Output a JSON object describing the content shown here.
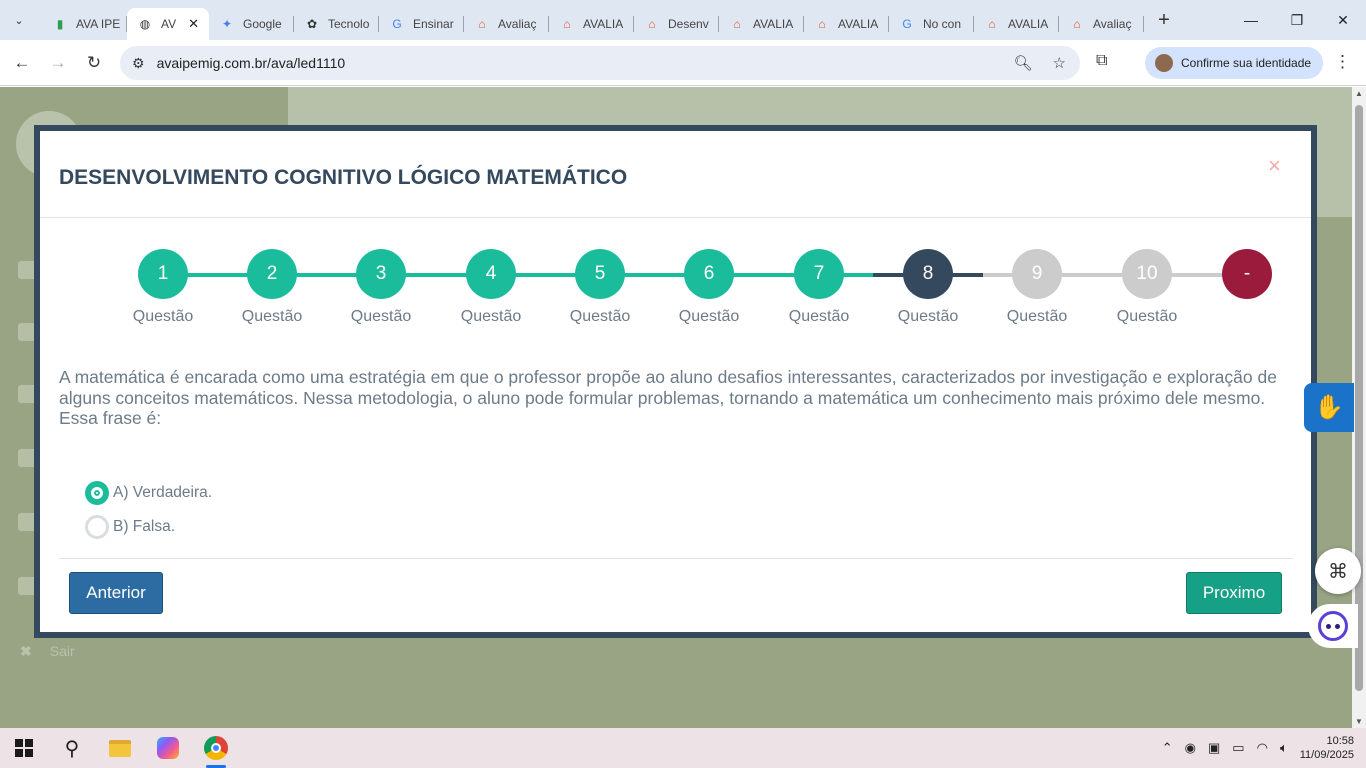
{
  "browser": {
    "tabs": [
      {
        "label": "AVA IPE",
        "icon": "ava-favicon",
        "active": false
      },
      {
        "label": "AV",
        "icon": "globe-icon",
        "active": true
      },
      {
        "label": "Google",
        "icon": "gemini-icon",
        "active": false
      },
      {
        "label": "Tecnolo",
        "icon": "openai-icon",
        "active": false
      },
      {
        "label": "Ensinar",
        "icon": "google-icon",
        "active": false
      },
      {
        "label": "Avaliaç",
        "icon": "ava-house-icon",
        "active": false
      },
      {
        "label": "AVALIA",
        "icon": "ava-house-icon",
        "active": false
      },
      {
        "label": "Desenv",
        "icon": "ava-house-icon",
        "active": false
      },
      {
        "label": "AVALIA",
        "icon": "ava-house-icon",
        "active": false
      },
      {
        "label": "AVALIA",
        "icon": "ava-house-icon",
        "active": false
      },
      {
        "label": "No con",
        "icon": "google-icon",
        "active": false
      },
      {
        "label": "AVALIA",
        "icon": "ava-house-icon",
        "active": false
      },
      {
        "label": "Avaliaç",
        "icon": "ava-house-icon",
        "active": false
      }
    ],
    "url": "avaipemig.com.br/ava/led1110",
    "profile_label": "Confirme sua identidade"
  },
  "page_bg": {
    "sidebar_exit": "Sair"
  },
  "modal": {
    "title": "DESENVOLVIMENTO COGNITIVO LÓGICO MATEMÁTICO",
    "close": "×",
    "steps": [
      {
        "num": "1",
        "label": "Questão",
        "state": "done"
      },
      {
        "num": "2",
        "label": "Questão",
        "state": "done"
      },
      {
        "num": "3",
        "label": "Questão",
        "state": "done"
      },
      {
        "num": "4",
        "label": "Questão",
        "state": "done"
      },
      {
        "num": "5",
        "label": "Questão",
        "state": "done"
      },
      {
        "num": "6",
        "label": "Questão",
        "state": "done"
      },
      {
        "num": "7",
        "label": "Questão",
        "state": "done"
      },
      {
        "num": "8",
        "label": "Questão",
        "state": "current"
      },
      {
        "num": "9",
        "label": "Questão",
        "state": "todo"
      },
      {
        "num": "10",
        "label": "Questão",
        "state": "todo"
      },
      {
        "num": "-",
        "label": "",
        "state": "end"
      }
    ],
    "question": "A matemática é encarada como uma estratégia em que o professor propõe ao aluno desafios interessantes, caracterizados por investigação e exploração de alguns conceitos matemáticos. Nessa metodologia, o aluno pode formular problemas, tornando a matemática um conhecimento mais próximo dele mesmo. Essa frase é:",
    "options": [
      {
        "label": "A) Verdadeira.",
        "selected": true
      },
      {
        "label": "B) Falsa.",
        "selected": false
      }
    ],
    "prev_label": "Anterior",
    "next_label": "Proximo"
  },
  "colors": {
    "done": "#1abc9c",
    "current": "#34495e",
    "todo": "#cccccc",
    "end": "#9b1b3d",
    "title": "#34495e"
  },
  "taskbar": {
    "time": "10:58",
    "date": "11/09/2025"
  }
}
